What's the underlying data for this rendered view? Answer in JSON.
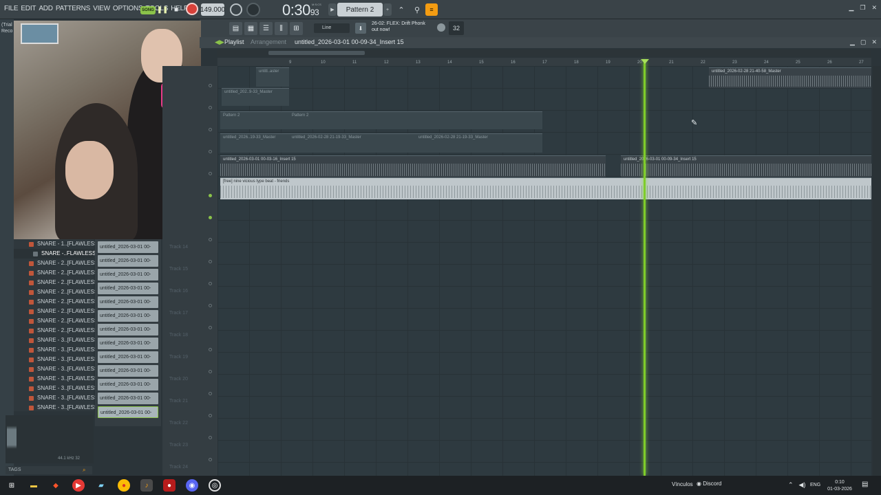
{
  "menu": [
    "FILE",
    "EDIT",
    "ADD",
    "PATTERNS",
    "VIEW",
    "OPTIONS",
    "TOOLS",
    "HELP"
  ],
  "transport": {
    "song_label": "SONG",
    "tempo": "149.000",
    "time_main": "0:30",
    "time_sub": "93",
    "mcs": "M:S:CS",
    "pattern": "Pattern 2"
  },
  "toolbar2": {
    "snap": "Line",
    "news_line1": "26-02: FLEX: Drift Phonk",
    "news_line2": "out now!",
    "cpu": "32"
  },
  "trial_text": [
    "(Trial",
    "Reco"
  ],
  "browser": {
    "items": [
      "SNARE - 1..[FLAWLESS]",
      "SNARE -..FLAWLESS]",
      "SNARE - 2..[FLAWLESS]",
      "SNARE - 2..[FLAWLESS]",
      "SNARE - 2..[FLAWLESS]",
      "SNARE - 2..[FLAWLESS]",
      "SNARE - 2..[FLAWLESS]",
      "SNARE - 2..[FLAWLESS]",
      "SNARE - 2..[FLAWLESS]",
      "SNARE - 2..[FLAWLESS]",
      "SNARE - 3..[FLAWLESS]",
      "SNARE - 3..[FLAWLESS]",
      "SNARE - 3..[FLAWLESS]",
      "SNARE - 3..[FLAWLESS]",
      "SNARE - 3..[FLAWLESS]",
      "SNARE - 3..[FLAWLESS]",
      "SNARE - 3..[FLAWLESS]",
      "SNARE - 3..[FLAWLESS]"
    ],
    "selected_index": 1,
    "sample_info": "44.1 kHz 32",
    "tags": "TAGS"
  },
  "clips": [
    "untitled_2026-03-01 00-",
    "untitled_2026-03-01 00-",
    "untitled_2026-03-01 00-",
    "untitled_2026-03-01 00-",
    "untitled_2026-03-01 00-",
    "untitled_2026-03-01 00-",
    "untitled_2026-03-01 00-",
    "untitled_2026-03-01 00-",
    "untitled_2026-03-01 00-",
    "untitled_2026-03-01 00-",
    "untitled_2026-03-01 00-",
    "untitled_2026-03-01 00-",
    "untitled_2026-03-01 00-"
  ],
  "playlist": {
    "title": "Playlist",
    "breadcrumb": "Arrangement",
    "name": "untitled_2026-03-01 00-09-34_Insert 15",
    "ruler": [
      "9",
      "10",
      "11",
      "12",
      "13",
      "14",
      "15",
      "16",
      "17",
      "18",
      "19",
      "20",
      "21",
      "22",
      "23",
      "24",
      "25",
      "26",
      "27"
    ],
    "track_labels": [
      "Track 14",
      "Track 15",
      "Track 16",
      "Track 17",
      "Track 18",
      "Track 19",
      "Track 20",
      "Track 21",
      "Track 22",
      "Track 23",
      "Track 24"
    ],
    "blocks": {
      "b1": "untitl..aster",
      "b2": "untitled_202..9-33_Master",
      "b3": "untitled_2026-02-28 21-40-58_Master",
      "b4": "Pattern 2",
      "b5": "Pattern 2",
      "b6": "untitled_2026..19-33_Master",
      "b7": "untitled_2026-02-28 21-19-33_Master",
      "b8": "untitled_2026-02-28 21-19-33_Master",
      "b9": "untitled_2026-03-01 00-03-16_Insert 15",
      "b10": "untitled_2026-03-01 00-09-34_Insert 15",
      "b11": "[free] nine vicious type beat - friends"
    }
  },
  "taskbar": {
    "vinculos": "Vínculos",
    "discord": "Discord",
    "lang": "ENG",
    "time": "0:10",
    "date": "01-03-2026"
  },
  "colors": {
    "accent_green": "#8bc34a",
    "record_red": "#d7413a",
    "orange": "#f39c12"
  }
}
